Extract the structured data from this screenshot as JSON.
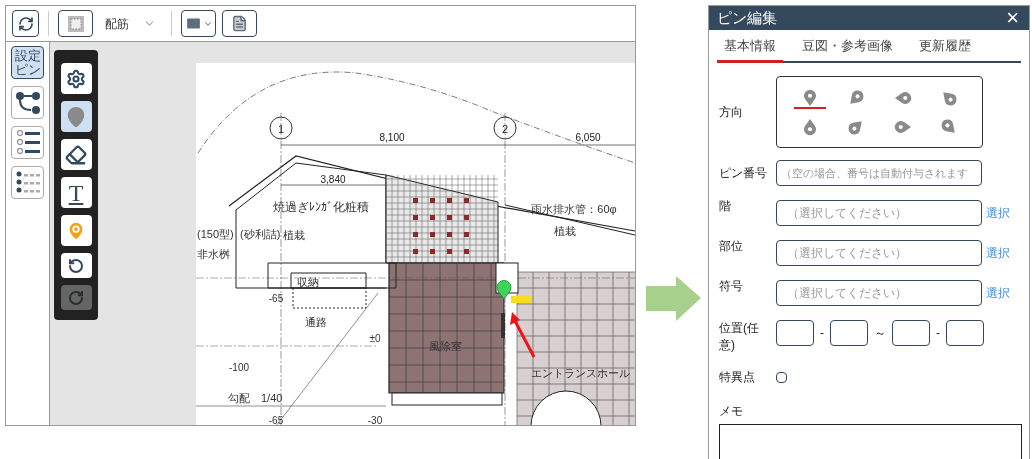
{
  "toolbar": {
    "layer_label": "配筋"
  },
  "sidebar": [
    {
      "kind": "label",
      "label": "設定ピン",
      "selected": true
    },
    {
      "kind": "route",
      "selected": false
    },
    {
      "kind": "pin-list",
      "selected": false
    },
    {
      "kind": "pin-table",
      "selected": false
    }
  ],
  "palette": [
    {
      "kind": "settings",
      "selected": false,
      "disabled": false
    },
    {
      "kind": "pin",
      "selected": true,
      "disabled": false
    },
    {
      "kind": "eraser",
      "selected": false,
      "disabled": false
    },
    {
      "kind": "text",
      "glyph": "T",
      "selected": false,
      "disabled": false
    },
    {
      "kind": "orange-pin",
      "selected": false,
      "disabled": false
    },
    {
      "kind": "undo",
      "selected": false,
      "disabled": false
    },
    {
      "kind": "redo",
      "selected": false,
      "disabled": true
    }
  ],
  "plan": {
    "labels": [
      {
        "text": "1",
        "kind": "grid"
      },
      {
        "text": "2",
        "kind": "grid"
      },
      {
        "text": "8,100",
        "kind": "dim"
      },
      {
        "text": "6,050",
        "kind": "dim"
      },
      {
        "text": "3,840",
        "kind": "dim"
      },
      {
        "text": "焼過ぎﾚﾝｶﾞ化粧積",
        "kind": "note"
      },
      {
        "text": "雨水排水管：60φ",
        "kind": "note"
      },
      {
        "text": "(150型)",
        "kind": "note"
      },
      {
        "text": "(砂利詰)",
        "kind": "note"
      },
      {
        "text": "植栽",
        "kind": "note"
      },
      {
        "text": "植栽",
        "kind": "note"
      },
      {
        "text": "非水桝",
        "kind": "note"
      },
      {
        "text": "収納",
        "kind": "note"
      },
      {
        "text": "-65",
        "kind": "level"
      },
      {
        "text": "通路",
        "kind": "note"
      },
      {
        "text": "±0",
        "kind": "level"
      },
      {
        "text": "風除室",
        "kind": "note"
      },
      {
        "text": "エントランスホール",
        "kind": "note"
      },
      {
        "text": "-100",
        "kind": "level"
      },
      {
        "text": "勾配　1/40",
        "kind": "note"
      },
      {
        "text": "-65",
        "kind": "level"
      },
      {
        "text": "-30",
        "kind": "level"
      }
    ]
  },
  "panel": {
    "title": "ピン編集",
    "close": "×",
    "tabs": [
      {
        "label": "基本情報",
        "selected": true
      },
      {
        "label": "豆図・参考画像",
        "selected": false
      },
      {
        "label": "更新履歴",
        "selected": false
      }
    ],
    "direction": {
      "label": "方向",
      "options": [
        {
          "kind": "south",
          "selected": true
        },
        {
          "kind": "southwest",
          "selected": false
        },
        {
          "kind": "west",
          "selected": false
        },
        {
          "kind": "northwest",
          "selected": false
        },
        {
          "kind": "north",
          "selected": false
        },
        {
          "kind": "northeast",
          "selected": false
        },
        {
          "kind": "east",
          "selected": false
        },
        {
          "kind": "southeast",
          "selected": false
        }
      ]
    },
    "pin_number": {
      "label": "ピン番号",
      "placeholder": "（空の場合、番号は自動付与されます"
    },
    "selects": [
      {
        "label": "階",
        "placeholder": "（選択してください）",
        "link": "選択"
      },
      {
        "label": "部位",
        "placeholder": "（選択してください）",
        "link": "選択"
      },
      {
        "label": "符号",
        "placeholder": "（選択してください）",
        "link": "選択"
      }
    ],
    "position": {
      "label": "位置(任意)",
      "separators": [
        "-",
        "～",
        "-"
      ]
    },
    "singular": {
      "label": "特異点",
      "checked": false
    },
    "memo": {
      "label": "メモ"
    }
  }
}
